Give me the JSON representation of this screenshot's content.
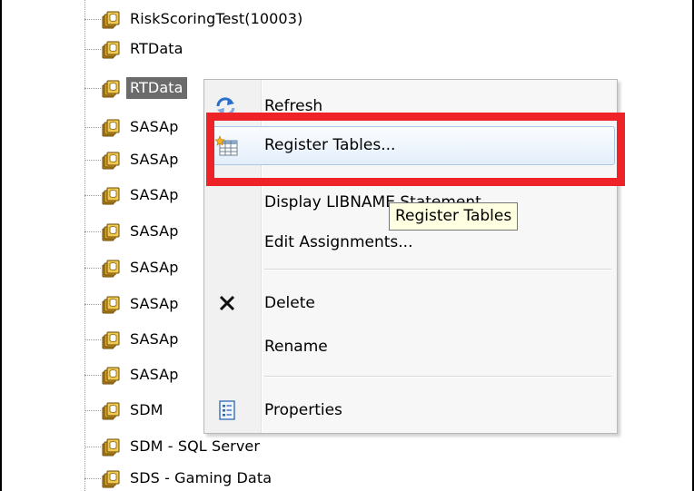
{
  "tree": {
    "items": [
      {
        "label": "RiskScoringTest(10003)",
        "selected": false
      },
      {
        "label": "RTData",
        "selected": false
      },
      {
        "label": "RTData",
        "selected": true
      },
      {
        "label": "SASAp",
        "selected": false
      },
      {
        "label": "SASAp",
        "selected": false
      },
      {
        "label": "SASAp",
        "selected": false
      },
      {
        "label": "SASAp",
        "selected": false
      },
      {
        "label": "SASAp",
        "selected": false
      },
      {
        "label": "SASAp",
        "selected": false
      },
      {
        "label": "SASAp",
        "selected": false
      },
      {
        "label": "SASAp",
        "selected": false
      },
      {
        "label": "SDM",
        "selected": false
      },
      {
        "label": "SDM - SQL Server",
        "selected": false
      },
      {
        "label": "SDS - Gaming Data",
        "selected": false
      }
    ]
  },
  "context_menu": {
    "items": [
      {
        "label": "Refresh",
        "icon": "refresh-icon"
      },
      {
        "label": "Register Tables...",
        "icon": "register-tables-icon"
      },
      {
        "label": "Display LIBNAME Statement...",
        "icon": ""
      },
      {
        "label": "Edit Assignments...",
        "icon": ""
      },
      {
        "label": "Delete",
        "icon": "delete-icon"
      },
      {
        "label": "Rename",
        "icon": ""
      },
      {
        "label": "Properties",
        "icon": "properties-icon"
      }
    ]
  },
  "tooltip": {
    "text": "Register Tables"
  },
  "colors": {
    "highlight_border": "#ee2328",
    "selection_bg": "#6b6b6b",
    "tooltip_bg": "#ffffe1",
    "menu_hover_border": "#a9c8ea"
  }
}
